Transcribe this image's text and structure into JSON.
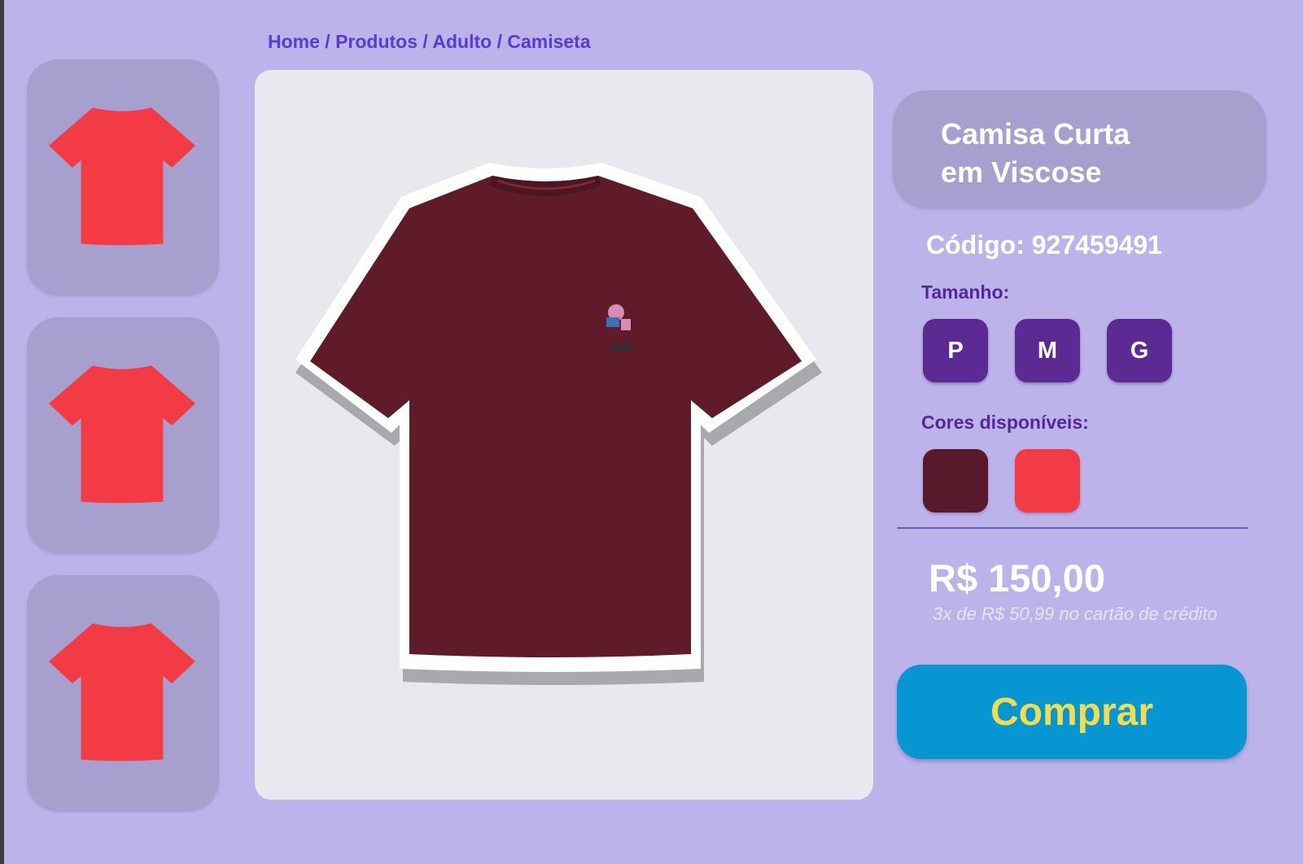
{
  "breadcrumb": {
    "items": [
      "Home",
      "Produtos",
      "Adulto",
      "Camiseta"
    ],
    "separator": "/"
  },
  "thumbnails": [
    {
      "icon": "tshirt-icon",
      "color": "#f23b44"
    },
    {
      "icon": "tshirt-icon",
      "color": "#f23b44"
    },
    {
      "icon": "tshirt-icon",
      "color": "#f23b44"
    }
  ],
  "main_image": {
    "shirt_color": "#5f1b2a"
  },
  "product": {
    "title_line1": "Camisa Curta",
    "title_line2": "em Viscose",
    "code_label": "Código: 927459491"
  },
  "sizes": {
    "label": "Tamanho:",
    "options": [
      "P",
      "M",
      "G"
    ]
  },
  "colors": {
    "label": "Cores disponíveis:",
    "options": [
      "#581a2a",
      "#f23b44"
    ]
  },
  "price": {
    "value": "R$ 150,00",
    "installments": "3x de R$ 50,99 no cartão de crédito"
  },
  "buy_button": {
    "label": "Comprar"
  },
  "theme": {
    "background": "#bcb3ea",
    "card": "#a79fcd",
    "accent_purple": "#5b2a92",
    "buy_blue": "#0896d3",
    "buy_text": "#f2dd52"
  }
}
